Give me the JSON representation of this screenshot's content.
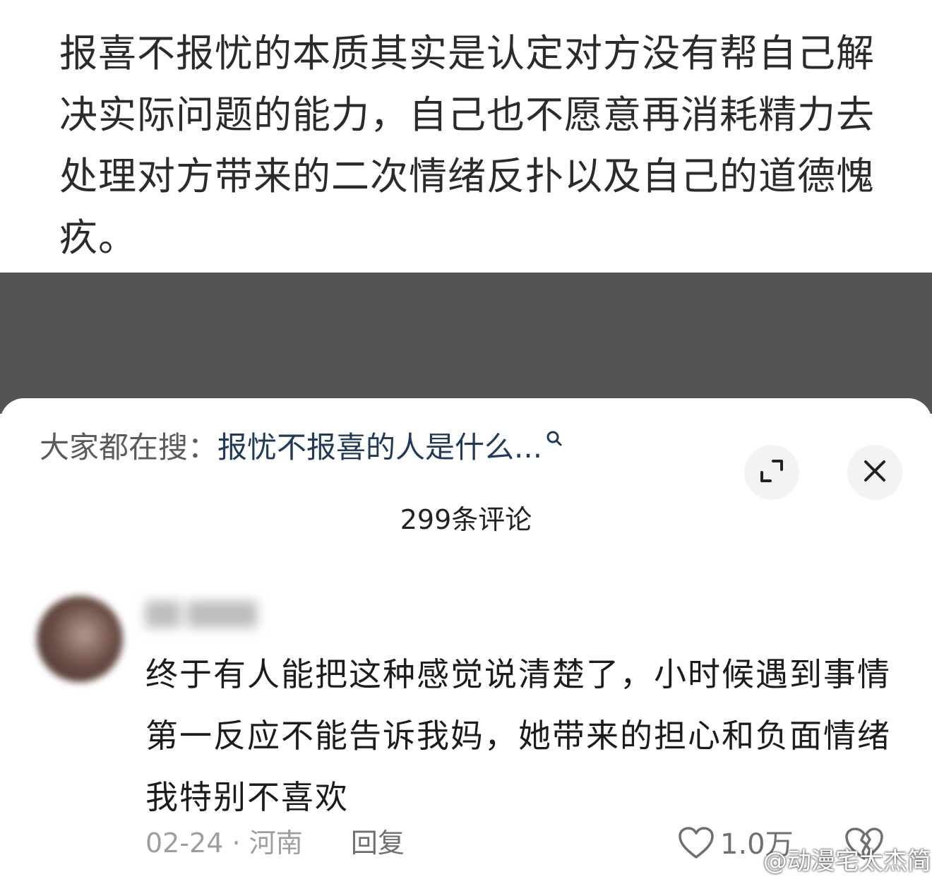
{
  "post": {
    "text": "报喜不报忧的本质其实是认定对方没有帮自己解决实际问题的能力，自己也不愿意再消耗精力去处理对方带来的二次情绪反扑以及自己的道德愧疚。"
  },
  "comments_sheet": {
    "search_prefix": "大家都在搜：",
    "search_query": "报忧不报喜的人是什么...",
    "comment_count_label": "299条评论"
  },
  "comment": {
    "text": "终于有人能把这种感觉说清楚了，小时候遇到事情第一反应不能告诉我妈，她带来的担心和负面情绪我特别不喜欢",
    "date": "02-24",
    "separator": "·",
    "location": "河南",
    "reply_label": "回复",
    "like_count": "1.0万"
  },
  "watermark": {
    "text": "@动漫宅太杰简"
  },
  "icons": [
    "search-icon",
    "expand-icon",
    "close-icon",
    "heart-icon",
    "broken-heart-icon",
    "weibo-logo-icon"
  ],
  "colors": {
    "search_query": "#1f3a5a",
    "overlay": "#545454",
    "meta_text": "#9e9e9e"
  }
}
